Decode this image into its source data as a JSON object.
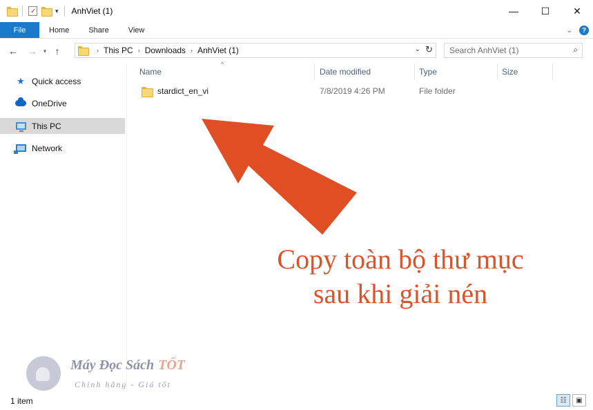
{
  "window": {
    "title": "AnhViet (1)",
    "controls": {
      "minimize": "—",
      "maximize": "☐",
      "close": "✕"
    }
  },
  "ribbon": {
    "tabs": [
      "File",
      "Home",
      "Share",
      "View"
    ],
    "expand_icon": "chevron-down-icon",
    "help_label": "?"
  },
  "address_bar": {
    "breadcrumbs": [
      "This PC",
      "Downloads",
      "AnhViet (1)"
    ]
  },
  "search": {
    "placeholder": "Search AnhViet (1)"
  },
  "nav_pane": {
    "items": [
      {
        "label": "Quick access",
        "icon": "star-icon",
        "selected": false
      },
      {
        "label": "OneDrive",
        "icon": "cloud-icon",
        "selected": false
      },
      {
        "label": "This PC",
        "icon": "computer-icon",
        "selected": true
      },
      {
        "label": "Network",
        "icon": "network-icon",
        "selected": false
      }
    ]
  },
  "file_list": {
    "columns": [
      "Name",
      "Date modified",
      "Type",
      "Size"
    ],
    "rows": [
      {
        "name": "stardict_en_vi",
        "date_modified": "7/8/2019 4:26 PM",
        "type": "File folder",
        "size": ""
      }
    ]
  },
  "annotation": {
    "line1": "Copy toàn bộ thư mục",
    "line2": "sau khi giải nén",
    "color": "#E04E24"
  },
  "watermark": {
    "brand": "Máy Đọc Sách",
    "brand_accent": "TỐT",
    "tagline": "Chính hãng - Giá tốt"
  },
  "status_bar": {
    "item_count": "1 item"
  }
}
